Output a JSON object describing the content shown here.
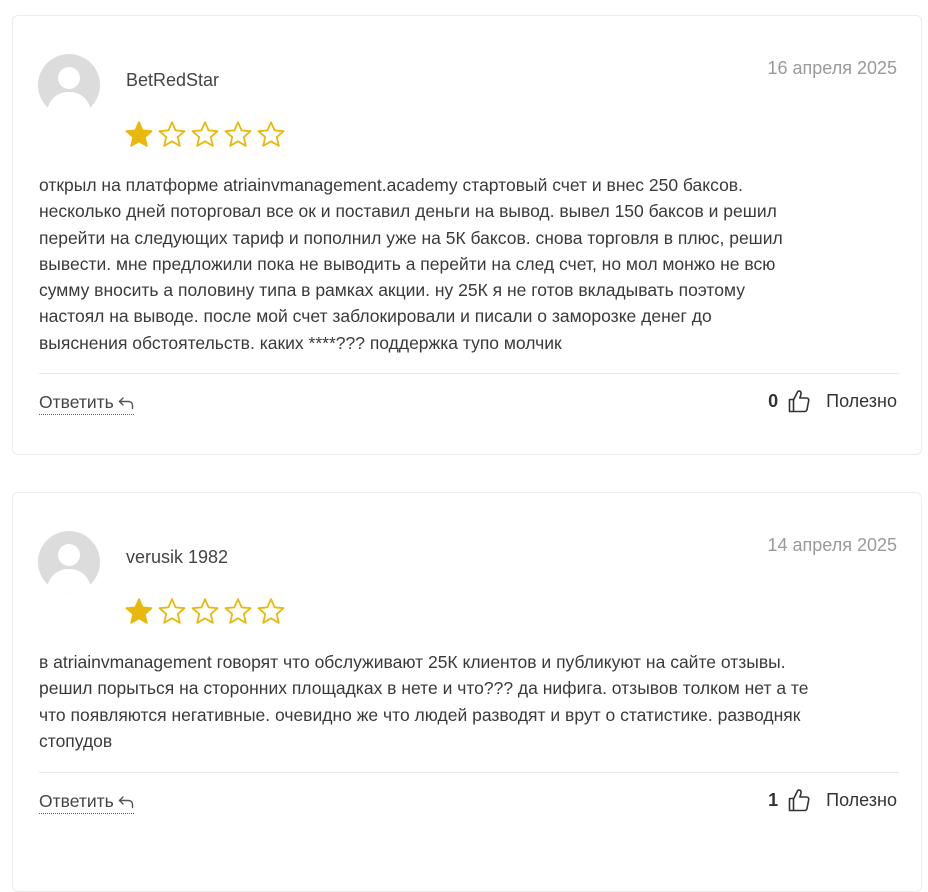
{
  "reviews": [
    {
      "author": "BetRedStar",
      "date": "16 апреля 2025",
      "rating": 1,
      "rating_max": 5,
      "text": "открыл на платформе atriainvmanagement.academy стартовый счет и внес 250 баксов.\nнесколько дней поторговал все ок и поставил деньги на вывод. вывел 150 баксов и решил\nперейти на следующих тариф и пополнил уже на 5К баксов. снова торговля в плюс, решил\nвывести. мне предложили пока не выводить а перейти на след счет, но мол монжо не всю\nсумму вносить а половину типа в рамках акции. ну 25К я не готов вкладывать поэтому\nнастоял на выводе. после мой счет заблокировали и писали о заморозке денег до\nвыяснения обстоятельств. каких ****??? поддержка тупо молчик",
      "reply_label": "Ответить",
      "helpful_count": "0",
      "helpful_label": "Полезно"
    },
    {
      "author": "verusik 1982",
      "date": "14 апреля 2025",
      "rating": 1,
      "rating_max": 5,
      "text": "в atriainvmanagement говорят что обслуживают 25К клиентов и публикуют на сайте отзывы.\nрешил порыться на сторонних площадках в нете и что??? да нифига. отзывов толком нет а те\nчто появляются негативные. очевидно же что людей разводят и врут о статистике. разводняк\nстопудов",
      "reply_label": "Ответить",
      "helpful_count": "1",
      "helpful_label": "Полезно"
    }
  ],
  "colors": {
    "star_filled": "#e8b90c",
    "star_outline": "#e8b90c",
    "avatar_bg": "#dcdcdc",
    "avatar_fg": "#ffffff",
    "date": "#9a9a9a",
    "border": "#ececec"
  },
  "icons": {
    "avatar": "user-silhouette-icon",
    "star_full": "star-filled-icon",
    "star_empty": "star-outline-icon",
    "reply": "reply-arrow-icon",
    "helpful": "thumbs-up-icon"
  }
}
